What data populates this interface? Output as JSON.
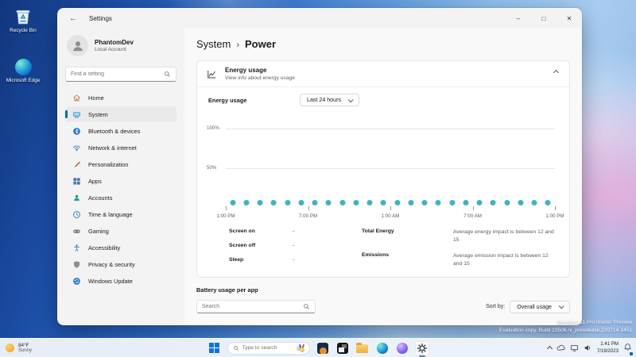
{
  "colors": {
    "accent": "#0067c0",
    "point": "#41b3c0"
  },
  "desktop": {
    "icons": [
      {
        "label": "Recycle Bin",
        "icon": "recycle-bin-icon"
      },
      {
        "label": "Microsoft Edge",
        "icon": "edge-icon"
      }
    ],
    "watermark": {
      "line1": "Windows 11 Pro Insider Preview",
      "line2": "Evaluation copy. Build 23506.ni_prerelease.230714-1451"
    }
  },
  "window": {
    "title": "Settings",
    "back_glyph": "←",
    "controls": {
      "minimize": "–",
      "maximize": "□",
      "close": "✕"
    }
  },
  "sidebar": {
    "user": {
      "name": "PhantomDev",
      "account_type": "Local Account"
    },
    "search_placeholder": "Find a setting",
    "items": [
      {
        "label": "Home",
        "icon": "home",
        "selected": false
      },
      {
        "label": "System",
        "icon": "system",
        "selected": true
      },
      {
        "label": "Bluetooth & devices",
        "icon": "bluetooth",
        "selected": false
      },
      {
        "label": "Network & internet",
        "icon": "network",
        "selected": false
      },
      {
        "label": "Personalization",
        "icon": "personalization",
        "selected": false
      },
      {
        "label": "Apps",
        "icon": "apps",
        "selected": false
      },
      {
        "label": "Accounts",
        "icon": "accounts",
        "selected": false
      },
      {
        "label": "Time & language",
        "icon": "time",
        "selected": false
      },
      {
        "label": "Gaming",
        "icon": "gaming",
        "selected": false
      },
      {
        "label": "Accessibility",
        "icon": "accessibility",
        "selected": false
      },
      {
        "label": "Privacy & security",
        "icon": "privacy",
        "selected": false
      },
      {
        "label": "Windows Update",
        "icon": "update",
        "selected": false
      }
    ]
  },
  "main": {
    "breadcrumb": {
      "root": "System",
      "separator": "›",
      "current": "Power"
    },
    "energy_card": {
      "title": "Energy usage",
      "subtitle": "View info about energy usage",
      "row_label": "Energy usage",
      "range_value": "Last 24 hours",
      "stats_left": [
        {
          "label": "Screen on",
          "value": "-"
        },
        {
          "label": "Screen off",
          "value": "-"
        },
        {
          "label": "Sleep",
          "value": "-"
        }
      ],
      "stats_right": [
        {
          "label": "Total Energy",
          "value": "Average energy impact is between 12 and 15"
        },
        {
          "label": "Emissions",
          "value": "Average emission impact is between 12 and 15"
        }
      ]
    },
    "battery_section": {
      "title": "Battery usage per app",
      "search_placeholder": "Search",
      "sort_label": "Sort by:",
      "sort_value": "Overall usage"
    }
  },
  "chart_data": {
    "type": "scatter",
    "title": "Energy usage - Last 24 hours",
    "x_ticks": [
      "1:00 PM",
      "7:00 PM",
      "1:00 AM",
      "7:00 AM",
      "1:00 PM"
    ],
    "y_ticks": [
      "100%",
      "50%"
    ],
    "ylim": [
      0,
      100
    ],
    "num_points": 24,
    "values": [
      2,
      2,
      2,
      2,
      2,
      2,
      2,
      2,
      2,
      2,
      2,
      2,
      2,
      2,
      2,
      2,
      2,
      2,
      2,
      2,
      2,
      2,
      2,
      2
    ],
    "point_color": "#41b3c0",
    "grid": true
  },
  "taskbar": {
    "weather": {
      "temperature": "84°F",
      "condition": "Sunny"
    },
    "search_placeholder": "Type to search",
    "app_icons": [
      "start",
      "search",
      "media-app",
      "black-app",
      "file-explorer",
      "edge",
      "copilot",
      "settings"
    ],
    "active_app": "settings",
    "tray": {
      "time": "1:41 PM",
      "date": "7/19/2023"
    }
  }
}
